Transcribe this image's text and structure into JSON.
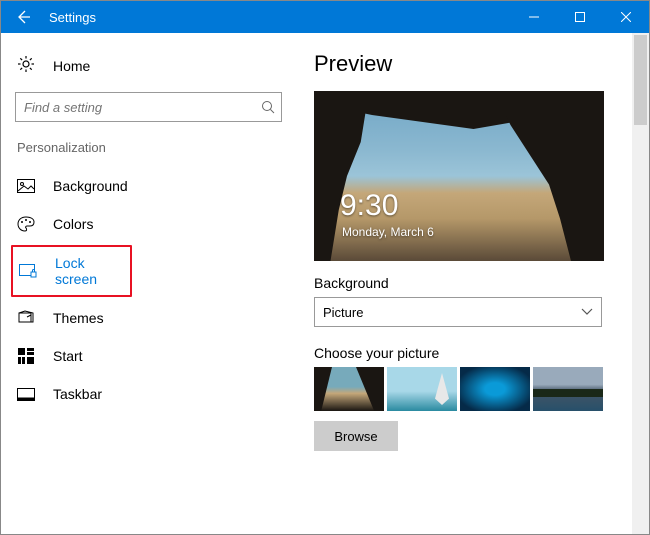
{
  "titlebar": {
    "title": "Settings"
  },
  "nav": {
    "home": "Home",
    "search_placeholder": "Find a setting",
    "section": "Personalization",
    "items": [
      {
        "label": "Background"
      },
      {
        "label": "Colors"
      },
      {
        "label": "Lock screen"
      },
      {
        "label": "Themes"
      },
      {
        "label": "Start"
      },
      {
        "label": "Taskbar"
      }
    ]
  },
  "main": {
    "preview_heading": "Preview",
    "lock_time": "9:30",
    "lock_date": "Monday, March 6",
    "background_label": "Background",
    "background_value": "Picture",
    "choose_label": "Choose your picture",
    "browse_label": "Browse"
  }
}
